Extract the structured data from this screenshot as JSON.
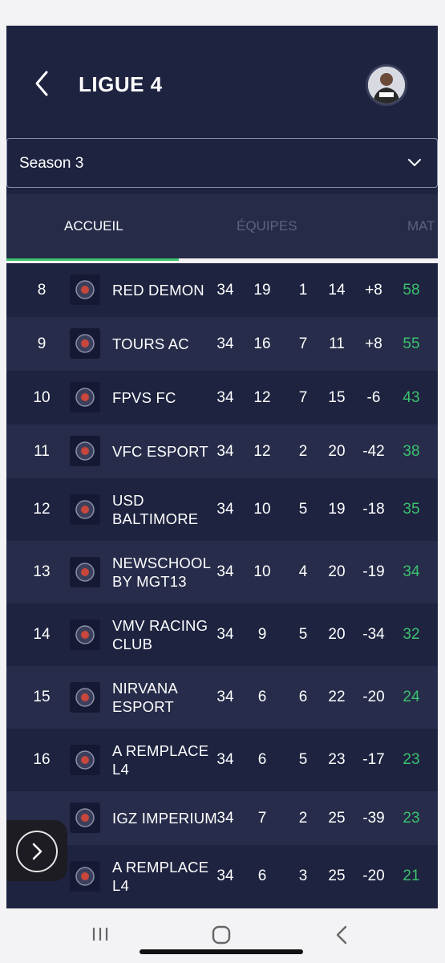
{
  "header": {
    "title": "LIGUE 4"
  },
  "season": {
    "selected": "Season 3"
  },
  "tabs": [
    {
      "label": "ACCUEIL",
      "active": true
    },
    {
      "label": "ÉQUIPES",
      "active": false
    },
    {
      "label": "MAT",
      "active": false
    }
  ],
  "standings": [
    {
      "pos": "8",
      "team": [
        "RED DEMON"
      ],
      "mp": "34",
      "w": "19",
      "d": "1",
      "l": "14",
      "gd": "+8",
      "pts": "58",
      "logo": "red-demon-logo"
    },
    {
      "pos": "9",
      "team": [
        "TOURS AC"
      ],
      "mp": "34",
      "w": "16",
      "d": "7",
      "l": "11",
      "gd": "+8",
      "pts": "55",
      "logo": "tours-ac-logo"
    },
    {
      "pos": "10",
      "team": [
        "FPVS FC"
      ],
      "mp": "34",
      "w": "12",
      "d": "7",
      "l": "15",
      "gd": "-6",
      "pts": "43",
      "logo": "fpvs-fc-logo"
    },
    {
      "pos": "11",
      "team": [
        "VFC ESPORT"
      ],
      "mp": "34",
      "w": "12",
      "d": "2",
      "l": "20",
      "gd": "-42",
      "pts": "38",
      "logo": "vfc-esport-logo"
    },
    {
      "pos": "12",
      "team": [
        "USD",
        "BALTIMORE"
      ],
      "mp": "34",
      "w": "10",
      "d": "5",
      "l": "19",
      "gd": "-18",
      "pts": "35",
      "logo": "usd-baltimore-logo"
    },
    {
      "pos": "13",
      "team": [
        "NEWSCHOOL",
        "BY MGT13"
      ],
      "mp": "34",
      "w": "10",
      "d": "4",
      "l": "20",
      "gd": "-19",
      "pts": "34",
      "logo": "newschool-logo"
    },
    {
      "pos": "14",
      "team": [
        "VMV RACING",
        "CLUB"
      ],
      "mp": "34",
      "w": "9",
      "d": "5",
      "l": "20",
      "gd": "-34",
      "pts": "32",
      "logo": "vmv-racing-logo"
    },
    {
      "pos": "15",
      "team": [
        "NIRVANA",
        "ESPORT"
      ],
      "mp": "34",
      "w": "6",
      "d": "6",
      "l": "22",
      "gd": "-20",
      "pts": "24",
      "logo": "nirvana-esport-logo"
    },
    {
      "pos": "16",
      "team": [
        "A REMPLACE",
        "L4"
      ],
      "mp": "34",
      "w": "6",
      "d": "5",
      "l": "23",
      "gd": "-17",
      "pts": "23",
      "logo": "a-remplace-logo"
    },
    {
      "pos": "",
      "team": [
        "IGZ IMPERIUM"
      ],
      "mp": "34",
      "w": "7",
      "d": "2",
      "l": "25",
      "gd": "-39",
      "pts": "23",
      "logo": "igz-imperium-logo"
    },
    {
      "pos": "18",
      "team": [
        "A REMPLACE",
        "L4"
      ],
      "mp": "34",
      "w": "6",
      "d": "3",
      "l": "25",
      "gd": "-20",
      "pts": "21",
      "logo": "a-remplace-logo"
    }
  ],
  "colors": {
    "background": "#1e2340",
    "row_alt": "#272c4a",
    "points": "#3cc26e",
    "tab_indicator": "#3cc26e"
  },
  "icons": {
    "back": "chevron-left-icon",
    "season_toggle": "chevron-down-icon",
    "float": "chevron-right-icon",
    "nav": [
      "recent-apps-icon",
      "home-icon",
      "back-icon"
    ]
  }
}
